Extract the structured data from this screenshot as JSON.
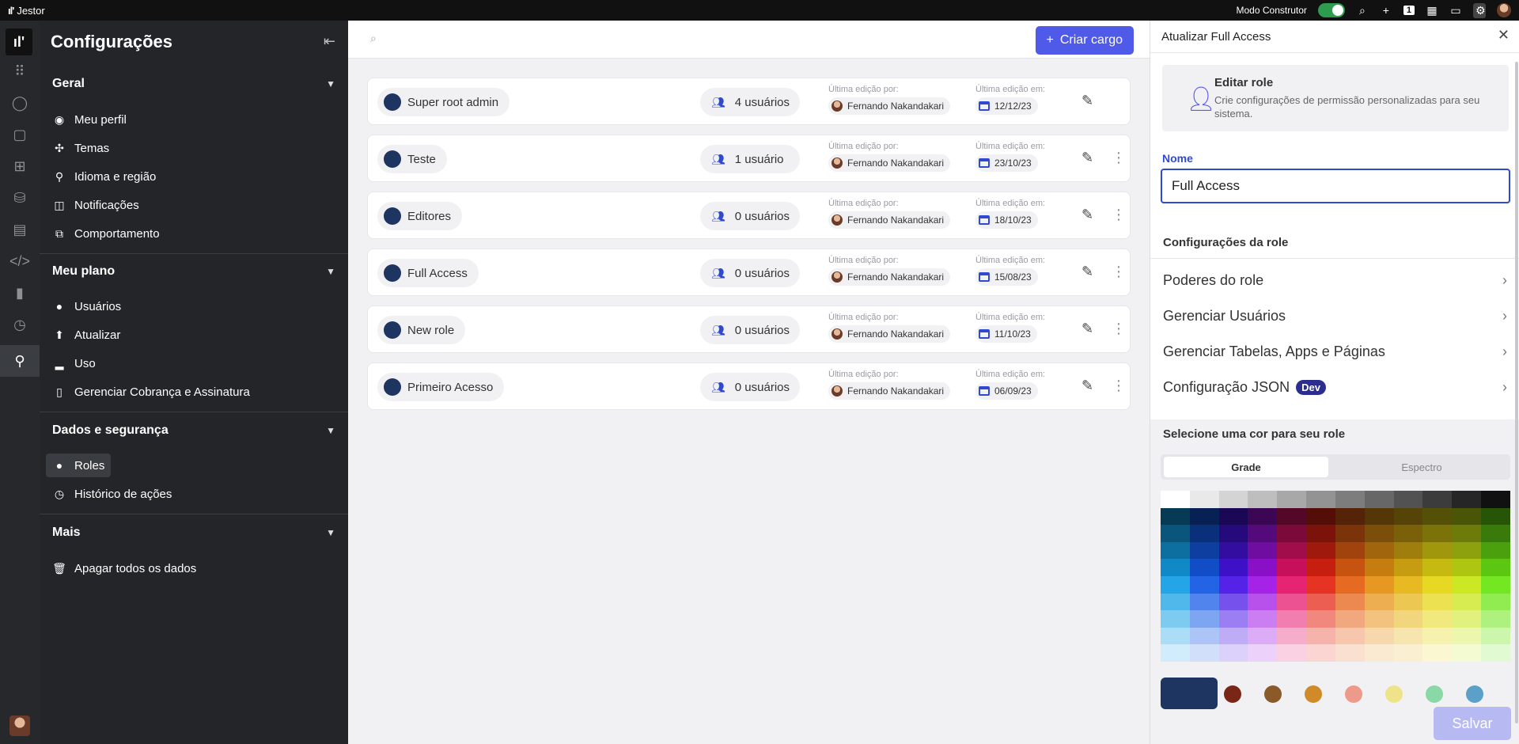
{
  "topbar": {
    "app_name": "Jestor",
    "builder_mode_label": "Modo Construtor",
    "badge_count": "1"
  },
  "settings": {
    "title": "Configurações",
    "sections": [
      {
        "title": "Geral",
        "items": [
          "Meu perfil",
          "Temas",
          "Idioma e região",
          "Notificações",
          "Comportamento"
        ]
      },
      {
        "title": "Meu plano",
        "items": [
          "Usuários",
          "Atualizar",
          "Uso",
          "Gerenciar Cobrança e Assinatura"
        ]
      },
      {
        "title": "Dados e segurança",
        "items": [
          "Roles",
          "Histórico de ações"
        ]
      },
      {
        "title": "Mais",
        "items": [
          "Apagar todos os dados"
        ]
      }
    ]
  },
  "main": {
    "create_button": "Criar cargo",
    "edited_by_label": "Última edição por:",
    "edited_on_label": "Última edição em:",
    "roles": [
      {
        "name": "Super root admin",
        "users": "4 usuários",
        "editor": "Fernando Nakandakari",
        "date": "12/12/23"
      },
      {
        "name": "Teste",
        "users": "1 usuário",
        "editor": "Fernando Nakandakari",
        "date": "23/10/23"
      },
      {
        "name": "Editores",
        "users": "0 usuários",
        "editor": "Fernando Nakandakari",
        "date": "18/10/23"
      },
      {
        "name": "Full Access",
        "users": "0 usuários",
        "editor": "Fernando Nakandakari",
        "date": "15/08/23"
      },
      {
        "name": "New role",
        "users": "0 usuários",
        "editor": "Fernando Nakandakari",
        "date": "11/10/23"
      },
      {
        "name": "Primeiro Acesso",
        "users": "0 usuários",
        "editor": "Fernando Nakandakari",
        "date": "06/09/23"
      }
    ]
  },
  "panel": {
    "title": "Atualizar Full Access",
    "info_title": "Editar role",
    "info_desc": "Crie configurações de permissão personalizadas para seu sistema.",
    "name_label": "Nome",
    "name_value": "Full Access",
    "config_title": "Configurações da role",
    "config_rows": [
      "Poderes do role",
      "Gerenciar Usuários",
      "Gerenciar Tabelas, Apps e Páginas",
      "Configuração JSON"
    ],
    "dev_badge": "Dev",
    "color_title": "Selecione uma cor para seu role",
    "tab_grid": "Grade",
    "tab_spectrum": "Espectro",
    "save_button": "Salvar",
    "selected_color": "#1e3461",
    "swatch_colors": [
      "#7a2617",
      "#8a5a2b",
      "#d08a2a",
      "#ee9a8a",
      "#efe38a",
      "#8ad8a8",
      "#5aa0c8"
    ]
  },
  "colors": {
    "accent": "#4f5ae8",
    "role_dot": "#1e3461",
    "sidebar_bg": "#232528"
  }
}
